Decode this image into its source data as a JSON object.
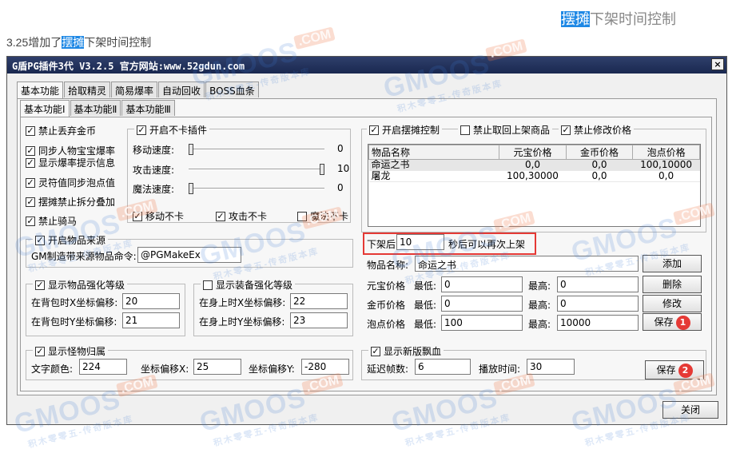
{
  "heading": {
    "highlight": "摆摊",
    "rest": "下架时间控制"
  },
  "intro": {
    "prefix": "3.25增加了",
    "highlight": "摆摊",
    "suffix": "下架时间控制"
  },
  "window": {
    "title": "G盾PG插件3代 V3.2.5  官方网站:www.52gdun.com",
    "close": "×"
  },
  "tabs_top": [
    "基本功能",
    "拾取精灵",
    "简易爆率",
    "自动回收",
    "BOSS血条"
  ],
  "tabs_sub": [
    "基本功能Ⅰ",
    "基本功能Ⅱ",
    "基本功能Ⅲ"
  ],
  "left_checks": [
    {
      "label": "禁止丢弃金币",
      "checked": true
    },
    {
      "label": "同步人物宝宝爆率",
      "checked": true
    },
    {
      "label": "显示爆率提示信息",
      "checked": true
    },
    {
      "label": "灵符值同步泡点值",
      "checked": true
    },
    {
      "label": "摆摊禁止拆分叠加",
      "checked": true
    },
    {
      "label": "禁止骑马",
      "checked": true
    }
  ],
  "nocard": {
    "title": "开启不卡插件",
    "sliders": [
      {
        "label": "移动速度:",
        "value": "0",
        "level": 0
      },
      {
        "label": "攻击速度:",
        "value": "10",
        "level": 1
      },
      {
        "label": "魔法速度:",
        "value": "0",
        "level": 0
      }
    ],
    "checks": [
      {
        "label": "移动不卡",
        "checked": true
      },
      {
        "label": "攻击不卡",
        "checked": true
      },
      {
        "label": "魔法不卡",
        "checked": false
      }
    ]
  },
  "item_source": {
    "title": "开启物品来源",
    "label": "GM制造带来源物品命令:",
    "value": "@PGMakeEx"
  },
  "strengthen": {
    "title": "显示物品强化等级",
    "x_label": "在背包时X坐标偏移:",
    "x_value": "20",
    "y_label": "在背包时Y坐标偏移:",
    "y_value": "21"
  },
  "equip": {
    "title": "显示装备强化等级",
    "x_label": "在身上时X坐标偏移:",
    "x_value": "22",
    "y_label": "在身上时Y坐标偏移:",
    "y_value": "23"
  },
  "monster": {
    "title": "显示怪物归属",
    "color_label": "文字颜色:",
    "color_value": "224",
    "x_label": "坐标偏移X:",
    "x_value": "25",
    "y_label": "坐标偏移Y:",
    "y_value": "-280"
  },
  "stall": {
    "open_label": "开启摆摊控制",
    "no_retrieve_label": "禁止取回上架商品",
    "no_modify_label": "禁止修改价格",
    "columns": [
      "物品名称",
      "元宝价格",
      "金币价格",
      "泡点价格"
    ],
    "rows": [
      [
        "命运之书",
        "0,0",
        "0,0",
        "100,10000"
      ],
      [
        "屠龙",
        "100,30000",
        "0,0",
        "0,0"
      ]
    ],
    "delist_prefix": "下架后",
    "delist_value": "10",
    "delist_suffix": "秒后可以再次上架",
    "name_label": "物品名称:",
    "name_value": "命运之书",
    "yb_label": "元宝价格",
    "gold_label": "金币价格",
    "pd_label": "泡点价格",
    "min_label": "最低:",
    "max_label": "最高:",
    "yb_min": "0",
    "yb_max": "0",
    "gold_min": "0",
    "gold_max": "0",
    "pd_min": "100",
    "pd_max": "10000",
    "add": "添加",
    "delete": "删除",
    "modify": "修改",
    "save": "保存",
    "badge1": "1"
  },
  "blood": {
    "title": "显示新版飘血",
    "delay_label": "延迟帧数:",
    "delay_value": "6",
    "play_label": "播放时间:",
    "play_value": "30",
    "save": "保存",
    "badge2": "2"
  },
  "close_btn": "关闭",
  "watermark": {
    "brand": "GMOOS",
    "com": ".COM",
    "sub": "积木零零五-传奇版本库"
  },
  "colors": {
    "highlight": "#1e88e5",
    "badge": "#e53935",
    "titlebar": "#1a2850"
  }
}
